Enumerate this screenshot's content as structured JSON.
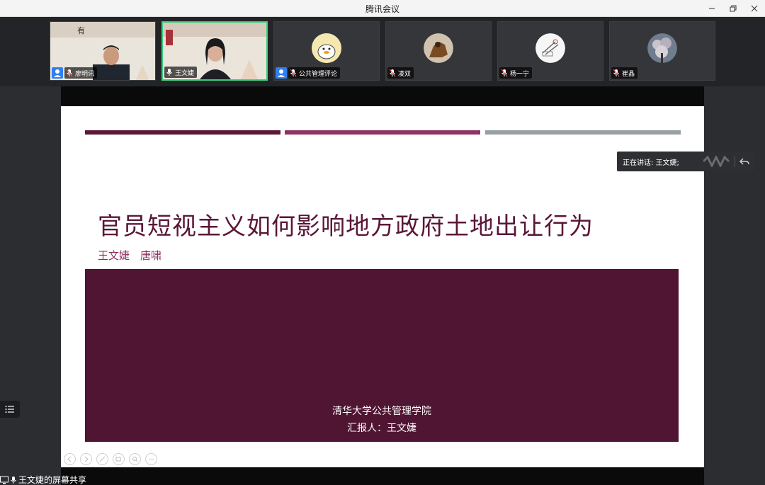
{
  "window": {
    "title": "腾讯会议"
  },
  "participants": [
    {
      "name": "廖明讯",
      "type": "video",
      "has_user_badge": true,
      "speaking": false
    },
    {
      "name": "王文婕",
      "type": "video",
      "has_user_badge": false,
      "speaking": true
    },
    {
      "name": "公共管理评论",
      "type": "avatar",
      "has_user_badge": true,
      "speaking": false
    },
    {
      "name": "凌双",
      "type": "avatar",
      "has_user_badge": false,
      "speaking": false
    },
    {
      "name": "杨一宁",
      "type": "avatar",
      "has_user_badge": false,
      "speaking": false
    },
    {
      "name": "崔晶",
      "type": "avatar",
      "has_user_badge": false,
      "speaking": false
    }
  ],
  "slide": {
    "title": "官员短视主义如何影响地方政府土地出让行为",
    "authors": "王文婕　唐啸",
    "institution": "清华大学公共管理学院",
    "reporter": "汇报人：王文婕",
    "bar_colors": [
      "#5a1738",
      "#8e3262",
      "#98a0a3"
    ]
  },
  "speaking_popup": {
    "text": "正在讲话: 王文婕;"
  },
  "share_status": {
    "text": "王文婕的屏幕共享"
  },
  "colors": {
    "slide_box": "#501533",
    "title": "#5a1738",
    "speaking_border": "#3ad07a"
  }
}
